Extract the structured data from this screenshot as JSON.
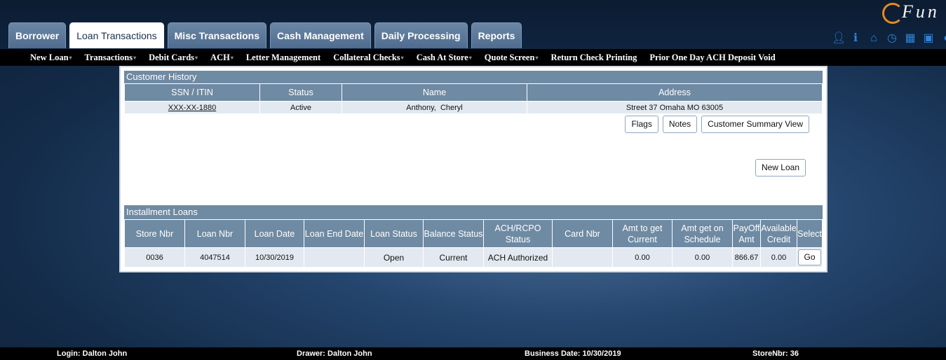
{
  "brand": {
    "logo_text": "Fun"
  },
  "tabs": [
    {
      "label": "Borrower",
      "active": false
    },
    {
      "label": "Loan Transactions",
      "active": true
    },
    {
      "label": "Misc Transactions",
      "active": false
    },
    {
      "label": "Cash Management",
      "active": false
    },
    {
      "label": "Daily Processing",
      "active": false
    },
    {
      "label": "Reports",
      "active": false
    }
  ],
  "toolbar_icons": [
    "user-icon",
    "info-icon",
    "home-icon",
    "clock-icon",
    "calculator-icon",
    "lock-icon",
    "more-icon"
  ],
  "subnav": [
    {
      "label": "New Loan",
      "dropdown": true
    },
    {
      "label": "Transactions",
      "dropdown": true
    },
    {
      "label": "Debit Cards",
      "dropdown": true
    },
    {
      "label": "ACH",
      "dropdown": true
    },
    {
      "label": "Letter Management",
      "dropdown": false
    },
    {
      "label": "Collateral Checks",
      "dropdown": true
    },
    {
      "label": "Cash At Store",
      "dropdown": true
    },
    {
      "label": "Quote Screen",
      "dropdown": true
    },
    {
      "label": "Return Check Printing",
      "dropdown": false
    },
    {
      "label": "Prior One Day ACH Deposit Void",
      "dropdown": false
    }
  ],
  "customer_history": {
    "title": "Customer History",
    "columns": [
      "SSN / ITIN",
      "Status",
      "Name",
      "Address"
    ],
    "row": {
      "ssn": "XXX-XX-1880",
      "status": "Active",
      "name": "Anthony,  Cheryl",
      "address": "Street 37 Omaha MO 63005"
    },
    "buttons": {
      "flags": "Flags",
      "notes": "Notes",
      "summary": "Customer Summary View"
    },
    "new_loan": "New Loan"
  },
  "installment_loans": {
    "title": "Installment Loans",
    "columns": [
      "Store Nbr",
      "Loan Nbr",
      "Loan Date",
      "Loan End Date",
      "Loan Status",
      "Balance Status",
      "ACH/RCPO Status",
      "Card Nbr",
      "Amt to get Current",
      "Amt get on Schedule",
      "PayOff Amt",
      "Available Credit",
      "Select"
    ],
    "row": {
      "store_nbr": "0036",
      "loan_nbr": "4047514",
      "loan_date": "10/30/2019",
      "loan_end_date": "",
      "loan_status": "Open",
      "balance_status": "Current",
      "ach_status": "ACH Authorized",
      "card_nbr": "",
      "amt_current": "0.00",
      "amt_schedule": "0.00",
      "payoff": "866.67",
      "available_credit": "0.00",
      "select_label": "Go"
    }
  },
  "footer": {
    "login": "Login: Dalton John",
    "drawer": "Drawer: Dalton John",
    "business_date": "Business Date: 10/30/2019",
    "store": "StoreNbr: 36"
  }
}
